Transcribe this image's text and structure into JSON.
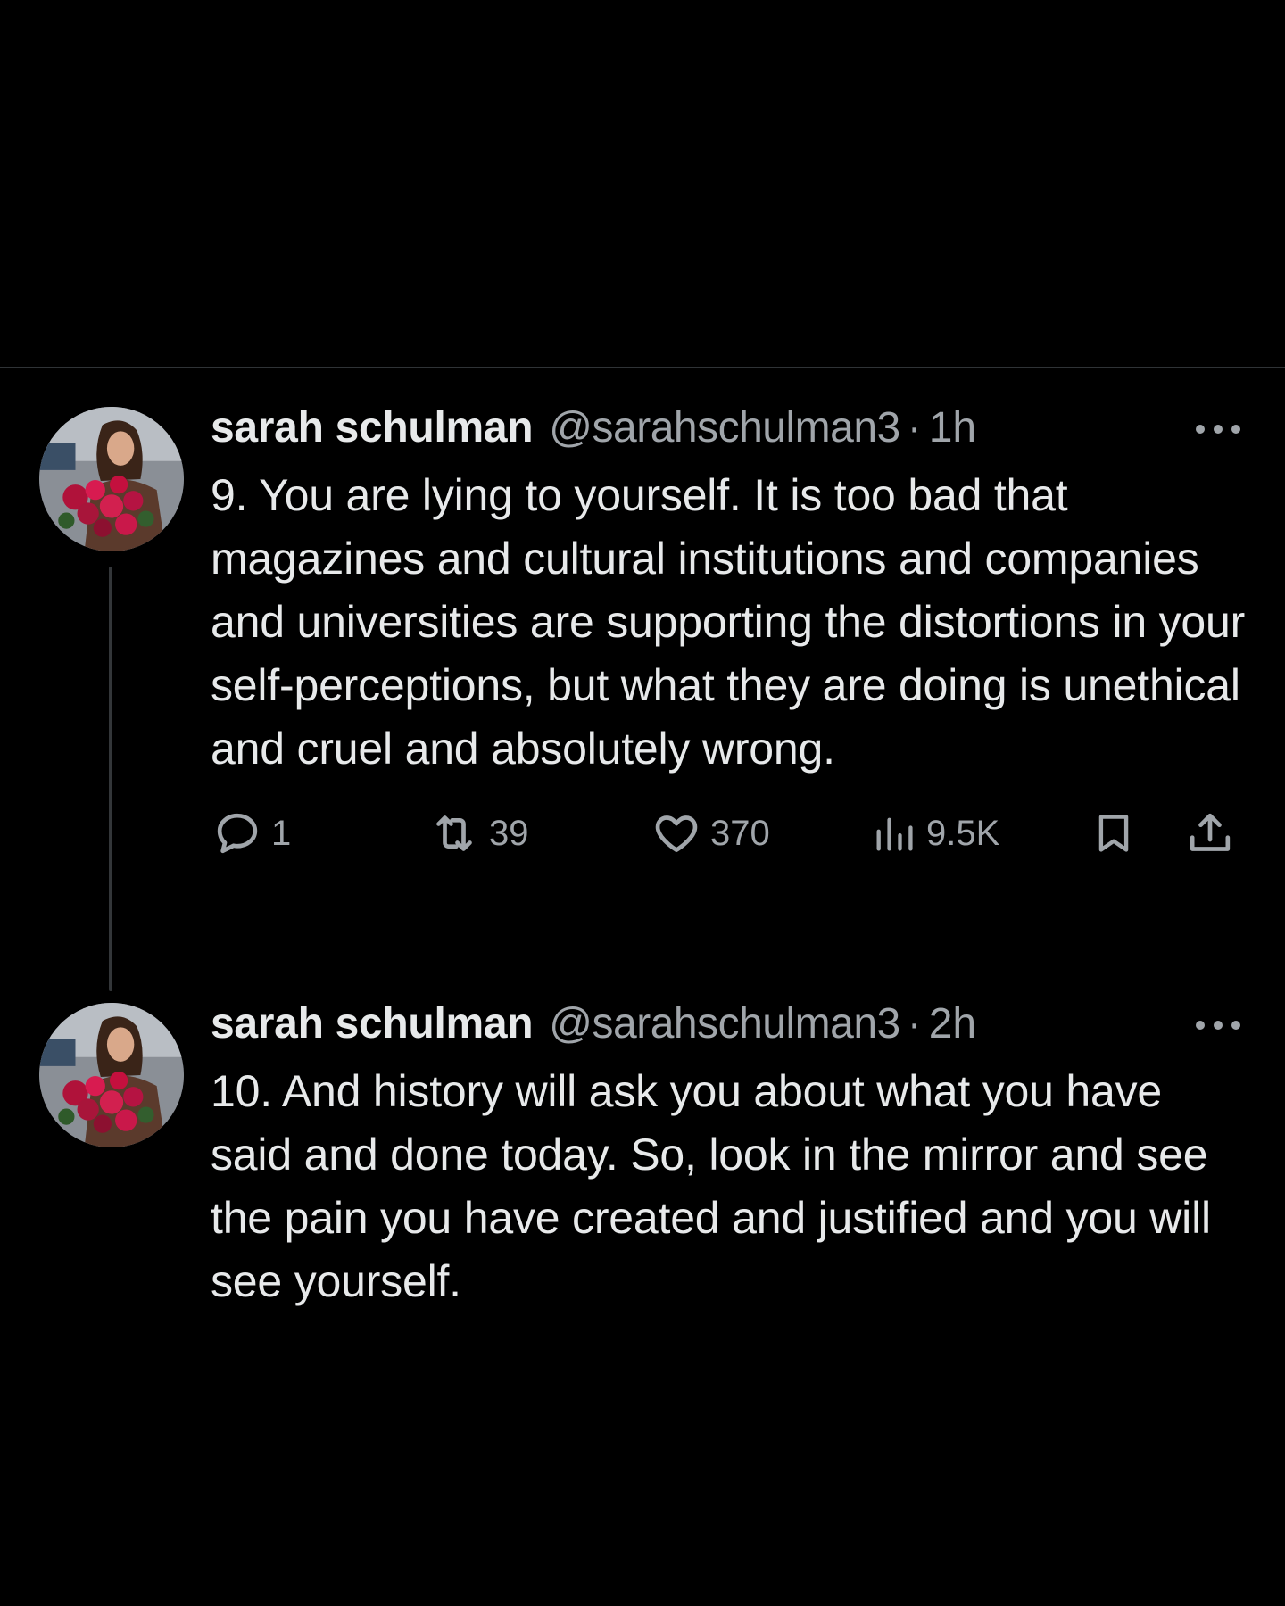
{
  "tweets": [
    {
      "display_name": "sarah schulman",
      "handle": "@sarahschulman3",
      "separator": "·",
      "time": "1h",
      "text": "9. You are lying to yourself. It is too bad that magazines and cultural institutions and companies and universities are supporting the distortions in your self-perceptions, but what they are doing is unethical and cruel and absolutely wrong.",
      "stats": {
        "replies": "1",
        "reposts": "39",
        "likes": "370",
        "views": "9.5K"
      }
    },
    {
      "display_name": "sarah schulman",
      "handle": "@sarahschulman3",
      "separator": "·",
      "time": "2h",
      "text": "10. And history will ask you about what you have said and done today. So, look in the mirror and see the pain you have created and justified and you will see yourself."
    }
  ],
  "icons": {
    "more": "more-dots-icon",
    "reply": "reply-icon",
    "repost": "repost-icon",
    "like": "heart-icon",
    "views": "views-chart-icon",
    "bookmark": "bookmark-icon",
    "share": "share-icon"
  },
  "colors": {
    "background": "#000000",
    "primary_text": "#e7e9ea",
    "secondary_text": "#a0a5aa",
    "divider": "#2f3336",
    "thread_line": "#333639"
  }
}
